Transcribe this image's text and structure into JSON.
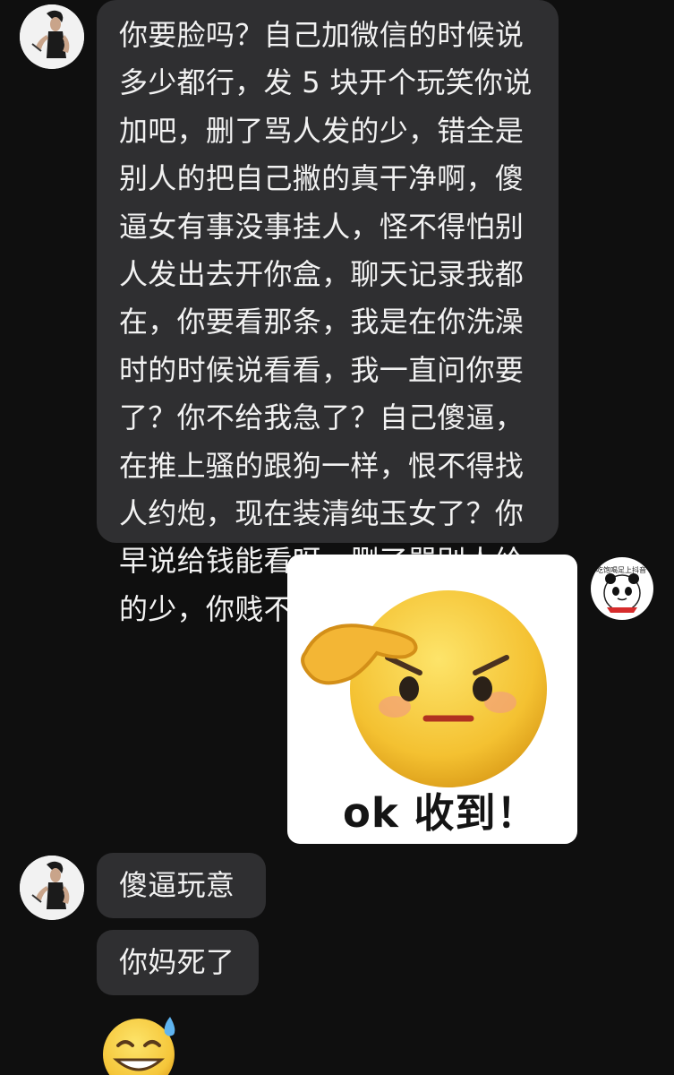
{
  "messages": {
    "incoming_1": {
      "lines": [
        "你要脸吗？自己加微信的时候说",
        "多少都行，发 5 块开个玩笑你说",
        "加吧，删了骂人发的少，错全是",
        "别人的把自己撇的真干净啊，傻",
        "逼女有事没事挂人，怪不得怕别",
        "人发出去开你盒，聊天记录我都",
        "在，你要看那条，我是在你洗澡",
        "时的时候说看看，我一直问你要",
        "了？你不给我急了？自己傻逼，",
        "在推上骚的跟狗一样，恨不得找",
        "人约炮，现在装清纯玉女了？你",
        "早说给钱能看呀，删了骂别人给",
        "的少，你贱不贱"
      ]
    },
    "outgoing_sticker": {
      "caption": "ok 收到！",
      "icon": "saluting-face-emoji-sticker"
    },
    "outgoing_avatar": {
      "text": "吃饱喝足上抖音",
      "icon": "panda-meme-avatar"
    },
    "incoming_2": {
      "text": "傻逼玩意"
    },
    "incoming_3": {
      "text": "你妈死了"
    },
    "incoming_4": {
      "icon": "grinning-sweat-face-emoji"
    }
  },
  "colors": {
    "background": "#0f0f0f",
    "bubble": "#2f2f31",
    "bubble_text": "#f2f2f2",
    "emoji_yellow": "#f5c63a"
  }
}
